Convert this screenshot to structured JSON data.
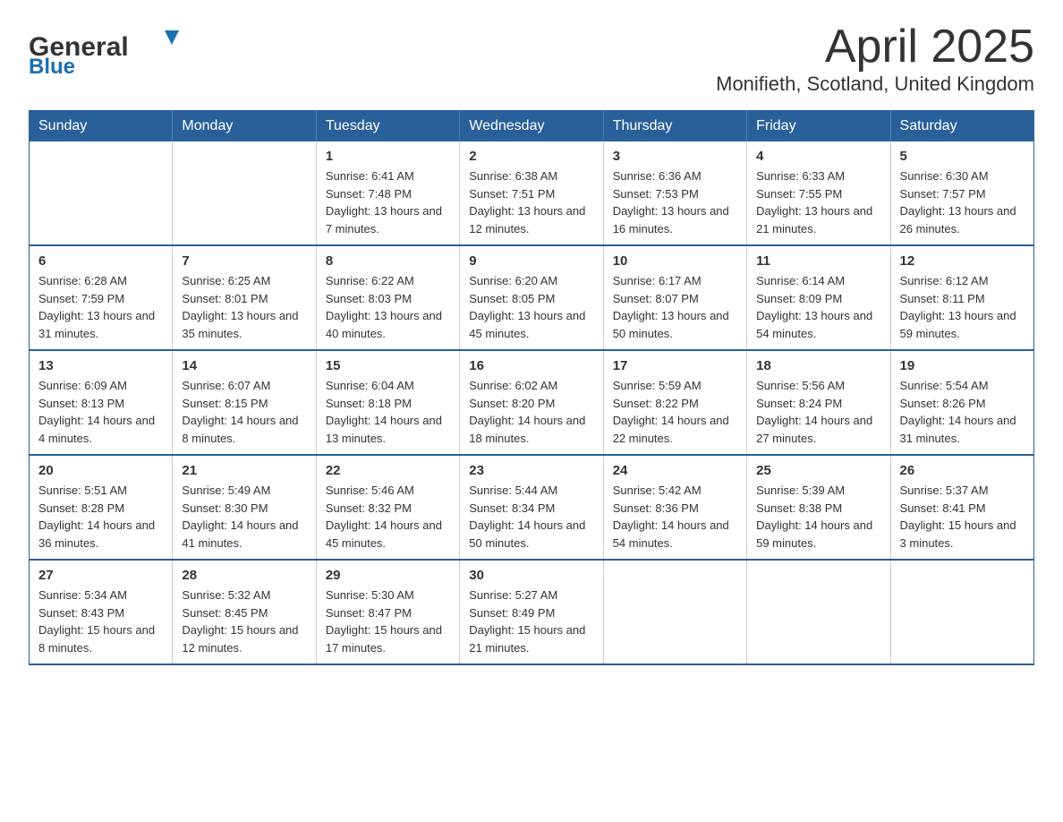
{
  "header": {
    "logo_general": "General",
    "logo_blue": "Blue",
    "month": "April 2025",
    "location": "Monifieth, Scotland, United Kingdom"
  },
  "weekdays": [
    "Sunday",
    "Monday",
    "Tuesday",
    "Wednesday",
    "Thursday",
    "Friday",
    "Saturday"
  ],
  "weeks": [
    [
      {
        "day": "",
        "sunrise": "",
        "sunset": "",
        "daylight": ""
      },
      {
        "day": "",
        "sunrise": "",
        "sunset": "",
        "daylight": ""
      },
      {
        "day": "1",
        "sunrise": "Sunrise: 6:41 AM",
        "sunset": "Sunset: 7:48 PM",
        "daylight": "Daylight: 13 hours and 7 minutes."
      },
      {
        "day": "2",
        "sunrise": "Sunrise: 6:38 AM",
        "sunset": "Sunset: 7:51 PM",
        "daylight": "Daylight: 13 hours and 12 minutes."
      },
      {
        "day": "3",
        "sunrise": "Sunrise: 6:36 AM",
        "sunset": "Sunset: 7:53 PM",
        "daylight": "Daylight: 13 hours and 16 minutes."
      },
      {
        "day": "4",
        "sunrise": "Sunrise: 6:33 AM",
        "sunset": "Sunset: 7:55 PM",
        "daylight": "Daylight: 13 hours and 21 minutes."
      },
      {
        "day": "5",
        "sunrise": "Sunrise: 6:30 AM",
        "sunset": "Sunset: 7:57 PM",
        "daylight": "Daylight: 13 hours and 26 minutes."
      }
    ],
    [
      {
        "day": "6",
        "sunrise": "Sunrise: 6:28 AM",
        "sunset": "Sunset: 7:59 PM",
        "daylight": "Daylight: 13 hours and 31 minutes."
      },
      {
        "day": "7",
        "sunrise": "Sunrise: 6:25 AM",
        "sunset": "Sunset: 8:01 PM",
        "daylight": "Daylight: 13 hours and 35 minutes."
      },
      {
        "day": "8",
        "sunrise": "Sunrise: 6:22 AM",
        "sunset": "Sunset: 8:03 PM",
        "daylight": "Daylight: 13 hours and 40 minutes."
      },
      {
        "day": "9",
        "sunrise": "Sunrise: 6:20 AM",
        "sunset": "Sunset: 8:05 PM",
        "daylight": "Daylight: 13 hours and 45 minutes."
      },
      {
        "day": "10",
        "sunrise": "Sunrise: 6:17 AM",
        "sunset": "Sunset: 8:07 PM",
        "daylight": "Daylight: 13 hours and 50 minutes."
      },
      {
        "day": "11",
        "sunrise": "Sunrise: 6:14 AM",
        "sunset": "Sunset: 8:09 PM",
        "daylight": "Daylight: 13 hours and 54 minutes."
      },
      {
        "day": "12",
        "sunrise": "Sunrise: 6:12 AM",
        "sunset": "Sunset: 8:11 PM",
        "daylight": "Daylight: 13 hours and 59 minutes."
      }
    ],
    [
      {
        "day": "13",
        "sunrise": "Sunrise: 6:09 AM",
        "sunset": "Sunset: 8:13 PM",
        "daylight": "Daylight: 14 hours and 4 minutes."
      },
      {
        "day": "14",
        "sunrise": "Sunrise: 6:07 AM",
        "sunset": "Sunset: 8:15 PM",
        "daylight": "Daylight: 14 hours and 8 minutes."
      },
      {
        "day": "15",
        "sunrise": "Sunrise: 6:04 AM",
        "sunset": "Sunset: 8:18 PM",
        "daylight": "Daylight: 14 hours and 13 minutes."
      },
      {
        "day": "16",
        "sunrise": "Sunrise: 6:02 AM",
        "sunset": "Sunset: 8:20 PM",
        "daylight": "Daylight: 14 hours and 18 minutes."
      },
      {
        "day": "17",
        "sunrise": "Sunrise: 5:59 AM",
        "sunset": "Sunset: 8:22 PM",
        "daylight": "Daylight: 14 hours and 22 minutes."
      },
      {
        "day": "18",
        "sunrise": "Sunrise: 5:56 AM",
        "sunset": "Sunset: 8:24 PM",
        "daylight": "Daylight: 14 hours and 27 minutes."
      },
      {
        "day": "19",
        "sunrise": "Sunrise: 5:54 AM",
        "sunset": "Sunset: 8:26 PM",
        "daylight": "Daylight: 14 hours and 31 minutes."
      }
    ],
    [
      {
        "day": "20",
        "sunrise": "Sunrise: 5:51 AM",
        "sunset": "Sunset: 8:28 PM",
        "daylight": "Daylight: 14 hours and 36 minutes."
      },
      {
        "day": "21",
        "sunrise": "Sunrise: 5:49 AM",
        "sunset": "Sunset: 8:30 PM",
        "daylight": "Daylight: 14 hours and 41 minutes."
      },
      {
        "day": "22",
        "sunrise": "Sunrise: 5:46 AM",
        "sunset": "Sunset: 8:32 PM",
        "daylight": "Daylight: 14 hours and 45 minutes."
      },
      {
        "day": "23",
        "sunrise": "Sunrise: 5:44 AM",
        "sunset": "Sunset: 8:34 PM",
        "daylight": "Daylight: 14 hours and 50 minutes."
      },
      {
        "day": "24",
        "sunrise": "Sunrise: 5:42 AM",
        "sunset": "Sunset: 8:36 PM",
        "daylight": "Daylight: 14 hours and 54 minutes."
      },
      {
        "day": "25",
        "sunrise": "Sunrise: 5:39 AM",
        "sunset": "Sunset: 8:38 PM",
        "daylight": "Daylight: 14 hours and 59 minutes."
      },
      {
        "day": "26",
        "sunrise": "Sunrise: 5:37 AM",
        "sunset": "Sunset: 8:41 PM",
        "daylight": "Daylight: 15 hours and 3 minutes."
      }
    ],
    [
      {
        "day": "27",
        "sunrise": "Sunrise: 5:34 AM",
        "sunset": "Sunset: 8:43 PM",
        "daylight": "Daylight: 15 hours and 8 minutes."
      },
      {
        "day": "28",
        "sunrise": "Sunrise: 5:32 AM",
        "sunset": "Sunset: 8:45 PM",
        "daylight": "Daylight: 15 hours and 12 minutes."
      },
      {
        "day": "29",
        "sunrise": "Sunrise: 5:30 AM",
        "sunset": "Sunset: 8:47 PM",
        "daylight": "Daylight: 15 hours and 17 minutes."
      },
      {
        "day": "30",
        "sunrise": "Sunrise: 5:27 AM",
        "sunset": "Sunset: 8:49 PM",
        "daylight": "Daylight: 15 hours and 21 minutes."
      },
      {
        "day": "",
        "sunrise": "",
        "sunset": "",
        "daylight": ""
      },
      {
        "day": "",
        "sunrise": "",
        "sunset": "",
        "daylight": ""
      },
      {
        "day": "",
        "sunrise": "",
        "sunset": "",
        "daylight": ""
      }
    ]
  ]
}
